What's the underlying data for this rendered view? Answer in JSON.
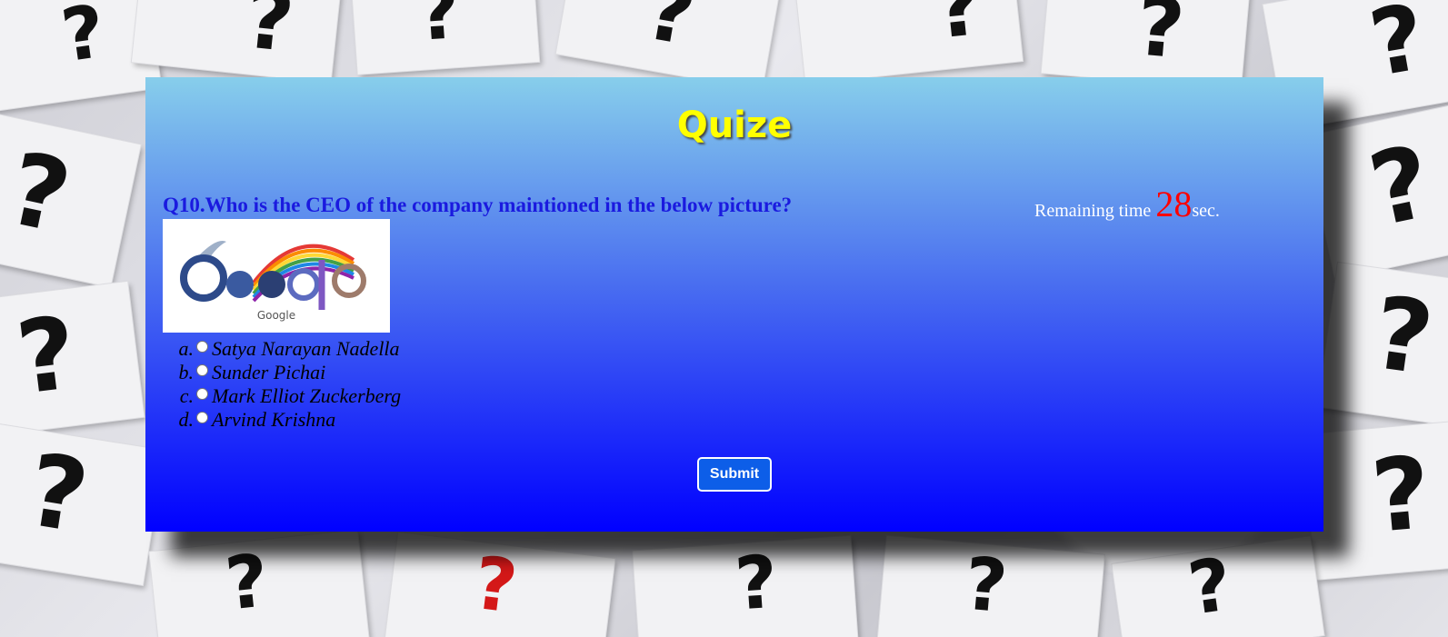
{
  "quiz": {
    "title": "Quize",
    "question": "Q10.Who is the CEO of the company maintioned in the below picture?",
    "timer": {
      "prefix": "Remaining time ",
      "count": "28",
      "suffix": "sec."
    },
    "picture": {
      "logo_text": "Google",
      "icon": "google-doodle-logo"
    },
    "options": [
      {
        "letter": "a.",
        "label": "Satya Narayan Nadella"
      },
      {
        "letter": "b.",
        "label": "Sunder Pichai"
      },
      {
        "letter": "c.",
        "label": "Mark Elliot Zuckerberg"
      },
      {
        "letter": "d.",
        "label": "Arvind Krishna"
      }
    ],
    "submit_label": "Submit"
  },
  "colors": {
    "title": "#ffff00",
    "question": "#1a1adf",
    "timer_count": "#ff0000",
    "panel_top": "#87ceeb",
    "panel_bottom": "#0000ff",
    "button": "#0d5ee8"
  }
}
